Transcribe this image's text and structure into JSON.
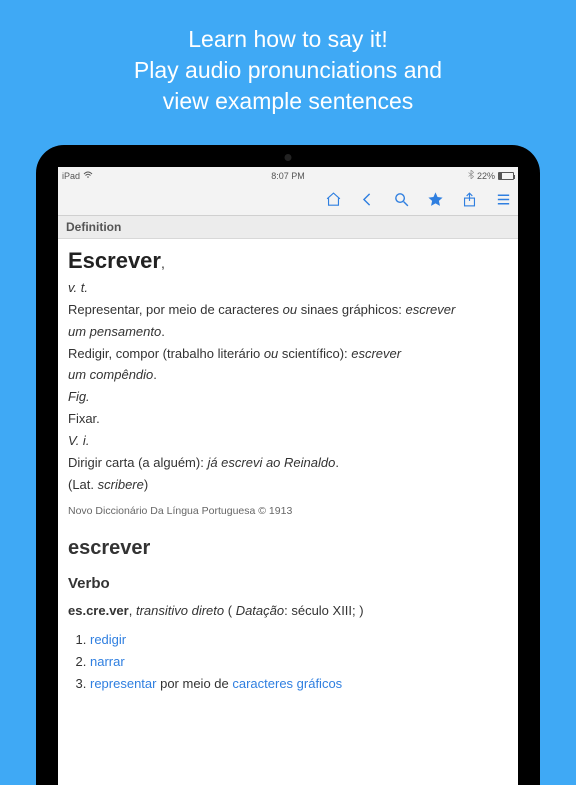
{
  "promo": {
    "line1": "Learn how to say it!",
    "line2": "Play audio pronunciations and",
    "line3": "view example sentences"
  },
  "statusbar": {
    "carrier": "iPad",
    "time": "8:07 PM",
    "battery_pct": "22%"
  },
  "section_header": "Definition",
  "entry1": {
    "headword": "Escrever",
    "comma": ",",
    "pos": "v. t.",
    "def1a": "Representar, por meio de caracteres ",
    "def1b_ital": "ou",
    "def1c": " sinaes gráphicos: ",
    "def1d_ital": "escrever",
    "def1e_ital": "um pensamento",
    "def1f": ".",
    "def2a": "Redigir, compor (trabalho literário ",
    "def2b_ital": "ou",
    "def2c": " scientífico): ",
    "def2d_ital": "escrever",
    "def2e_ital": "um compêndio",
    "def2f": ".",
    "fig": "Fig.",
    "fixar": "Fixar.",
    "vi": "V. i.",
    "def3a": "Dirigir carta (a alguém): ",
    "def3b_ital": "já escrevi ao Reinaldo",
    "def3c": ".",
    "etym_open": "(Lat. ",
    "etym_word": "scribere",
    "etym_close": ")",
    "copyright": "Novo Diccionário Da Língua Portuguesa © 1913"
  },
  "entry2": {
    "headword": "escrever",
    "part": "Verbo",
    "syllab": "es.cre.ver",
    "gram_sep": ", ",
    "gram_ital": "transitivo direto",
    "dating_open": " ( ",
    "dating_label": "Datação",
    "dating_val": ": século XIII; )",
    "senses": [
      {
        "link": "redigir",
        "rest": ""
      },
      {
        "link": "narrar",
        "rest": ""
      },
      {
        "link": "representar",
        "rest": " por meio de ",
        "link2": "caracteres gráficos"
      }
    ]
  },
  "colors": {
    "accent": "#2f7fe0",
    "bg": "#3fa9f5"
  }
}
